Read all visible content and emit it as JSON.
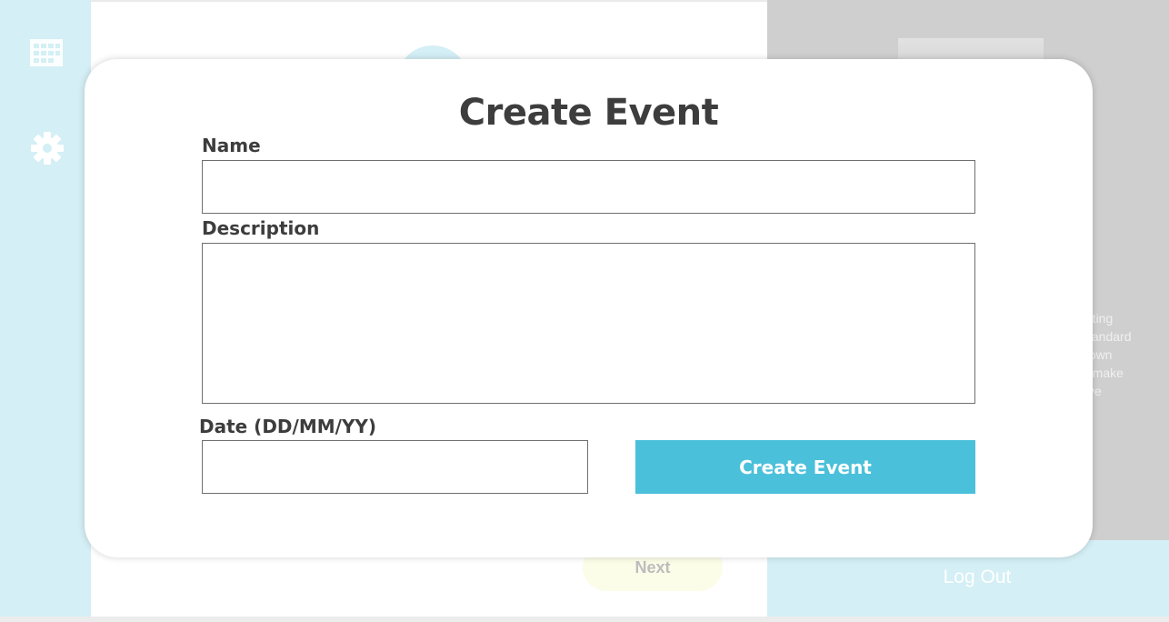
{
  "background": {
    "sidebar": {
      "icons": [
        "calendar-icon",
        "gear-icon"
      ]
    },
    "main": {
      "next_label": "Next"
    },
    "right_panel": {
      "blurb_lines": [
        "etting",
        "standard",
        "nown",
        "o make",
        "five"
      ],
      "logout_label": "Log Out"
    }
  },
  "modal": {
    "title": "Create Event",
    "name_label": "Name",
    "name_value": "",
    "description_label": "Description",
    "description_value": "",
    "date_label": "Date (DD/MM/YY)",
    "date_value": "",
    "submit_label": "Create Event"
  },
  "colors": {
    "accent": "#4bc0da",
    "sidebar_bg": "#d4eff5",
    "text": "#3d3d3d",
    "panel_gray": "#cfcfcf"
  }
}
